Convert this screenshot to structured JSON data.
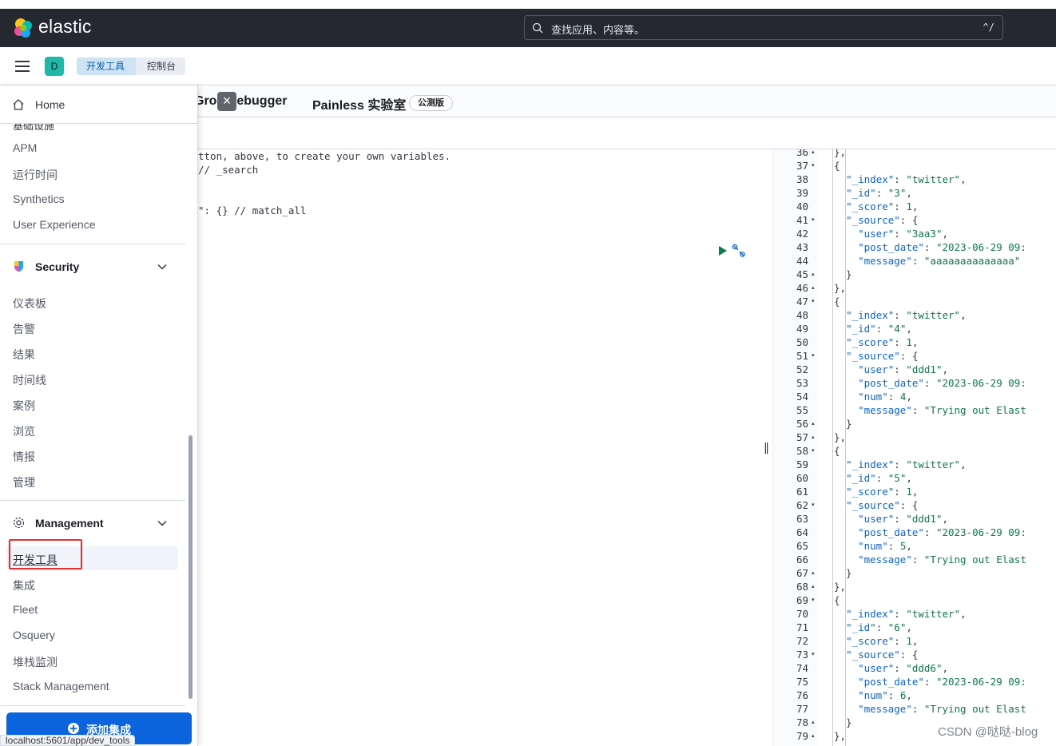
{
  "header": {
    "brand": "elastic",
    "search_placeholder": "查找应用、内容等。",
    "search_shortcut": "^/"
  },
  "subheader": {
    "avatar_initial": "D",
    "breadcrumbs": [
      "开发工具",
      "控制台"
    ]
  },
  "tabs": {
    "grok_partial": "Grok Debugger",
    "painless": "Painless 实验室",
    "painless_badge": "公测版",
    "close_glyph": "×"
  },
  "request_editor": {
    "lines": [
      "tton, above, to create your own variables.",
      "// _search",
      "\": {} // match_all"
    ]
  },
  "response": {
    "line_numbers": [
      "36",
      "37",
      "38",
      "39",
      "40",
      "41",
      "42",
      "43",
      "44",
      "45",
      "46",
      "47",
      "48",
      "49",
      "50",
      "51",
      "52",
      "53",
      "54",
      "55",
      "56",
      "57",
      "58",
      "59",
      "60",
      "61",
      "62",
      "63",
      "64",
      "65",
      "66",
      "67",
      "68",
      "69",
      "70",
      "71",
      "72",
      "73",
      "74",
      "75",
      "76",
      "77",
      "78",
      "79"
    ],
    "lines": [
      "},",
      "{",
      "  \"_index\": \"twitter\",",
      "  \"_id\": \"3\",",
      "  \"_score\": 1,",
      "  \"_source\": {",
      "    \"user\": \"3aa3\",",
      "    \"post_date\": \"2023-06-29 09:",
      "    \"message\": \"aaaaaaaaaaaaaa\"",
      "  }",
      "},",
      "{",
      "  \"_index\": \"twitter\",",
      "  \"_id\": \"4\",",
      "  \"_score\": 1,",
      "  \"_source\": {",
      "    \"user\": \"ddd1\",",
      "    \"post_date\": \"2023-06-29 09:",
      "    \"num\": 4,",
      "    \"message\": \"Trying out Elast",
      "  }",
      "},",
      "{",
      "  \"_index\": \"twitter\",",
      "  \"_id\": \"5\",",
      "  \"_score\": 1,",
      "  \"_source\": {",
      "    \"user\": \"ddd1\",",
      "    \"post_date\": \"2023-06-29 09:",
      "    \"num\": 5,",
      "    \"message\": \"Trying out Elast",
      "  }",
      "},",
      "{",
      "  \"_index\": \"twitter\",",
      "  \"_id\": \"6\",",
      "  \"_score\": 1,",
      "  \"_source\": {",
      "    \"user\": \"ddd6\",",
      "    \"post_date\": \"2023-06-29 09:",
      "    \"num\": 6,",
      "    \"message\": \"Trying out Elast",
      "  }",
      "},"
    ],
    "fold_markers": {
      "36": "▴",
      "37": "▾",
      "41": "▾",
      "45": "▴",
      "46": "▴",
      "47": "▾",
      "51": "▾",
      "56": "▴",
      "57": "▴",
      "58": "▾",
      "62": "▾",
      "67": "▴",
      "68": "▴",
      "69": "▾",
      "73": "▾",
      "78": "▴",
      "79": "▴"
    }
  },
  "nav": {
    "home": "Home",
    "cut_item": "基础设施",
    "observability_items": [
      "APM",
      "运行时间",
      "Synthetics",
      "User Experience"
    ],
    "security": {
      "title": "Security",
      "items": [
        "仪表板",
        "告警",
        "结果",
        "时间线",
        "案例",
        "浏览",
        "情报",
        "管理"
      ]
    },
    "management": {
      "title": "Management",
      "items": [
        "开发工具",
        "集成",
        "Fleet",
        "Osquery",
        "堆栈监测",
        "Stack Management"
      ]
    },
    "add_integrations": "添加集成"
  },
  "status_url": "localhost:5601/app/dev_tools",
  "watermark": "CSDN @哒哒-blog",
  "colors": {
    "header_bg": "#25282f",
    "accent_blue": "#0b64dd",
    "highlight_red": "#e3312f",
    "string_green": "#0e7a4d",
    "key_blue": "#0b64dd"
  }
}
